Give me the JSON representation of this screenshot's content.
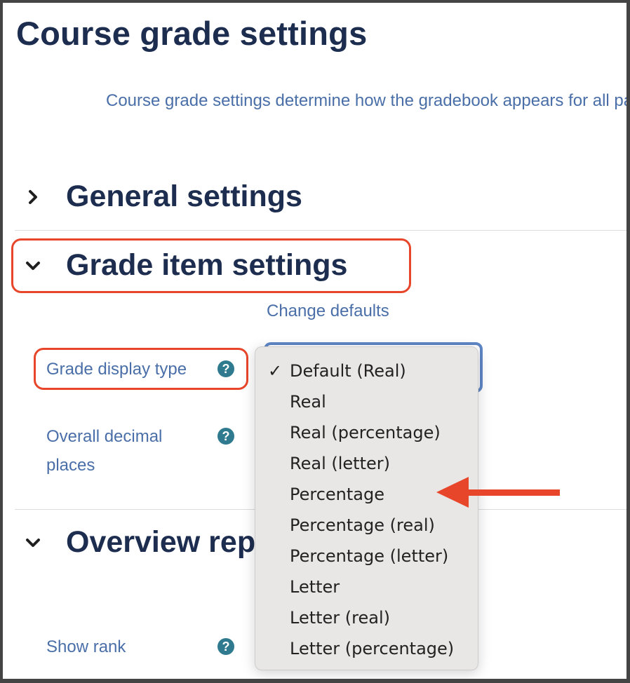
{
  "page": {
    "title": "Course grade settings",
    "intro": "Course grade settings determine how the gradebook appears for all participants in the course."
  },
  "sections": [
    {
      "title": "General settings",
      "state": "collapsed",
      "icon": "chevron-right-icon"
    },
    {
      "title": "Grade item settings",
      "state": "expanded",
      "icon": "chevron-down-icon",
      "highlighted": true
    },
    {
      "title": "Overview report",
      "state": "expanded",
      "icon": "chevron-down-icon"
    }
  ],
  "grade_item_settings": {
    "change_defaults_link": "Change defaults",
    "fields": [
      {
        "label": "Grade display type",
        "help_icon": "question-circle-icon",
        "highlighted": true
      },
      {
        "label_line1": "Overall decimal",
        "label_line2": "places",
        "help_icon": "question-circle-icon"
      }
    ]
  },
  "overview_report": {
    "fields": [
      {
        "label": "Show rank",
        "help_icon": "question-circle-icon"
      }
    ]
  },
  "dropdown": {
    "selected": "Default (Real)",
    "check_glyph": "✓",
    "options": [
      "Default (Real)",
      "Real",
      "Real (percentage)",
      "Real (letter)",
      "Percentage",
      "Percentage (real)",
      "Percentage (letter)",
      "Letter",
      "Letter (real)",
      "Letter (percentage)"
    ],
    "pointed_option": "Percentage"
  },
  "annotations": {
    "color": "#e8462a"
  }
}
